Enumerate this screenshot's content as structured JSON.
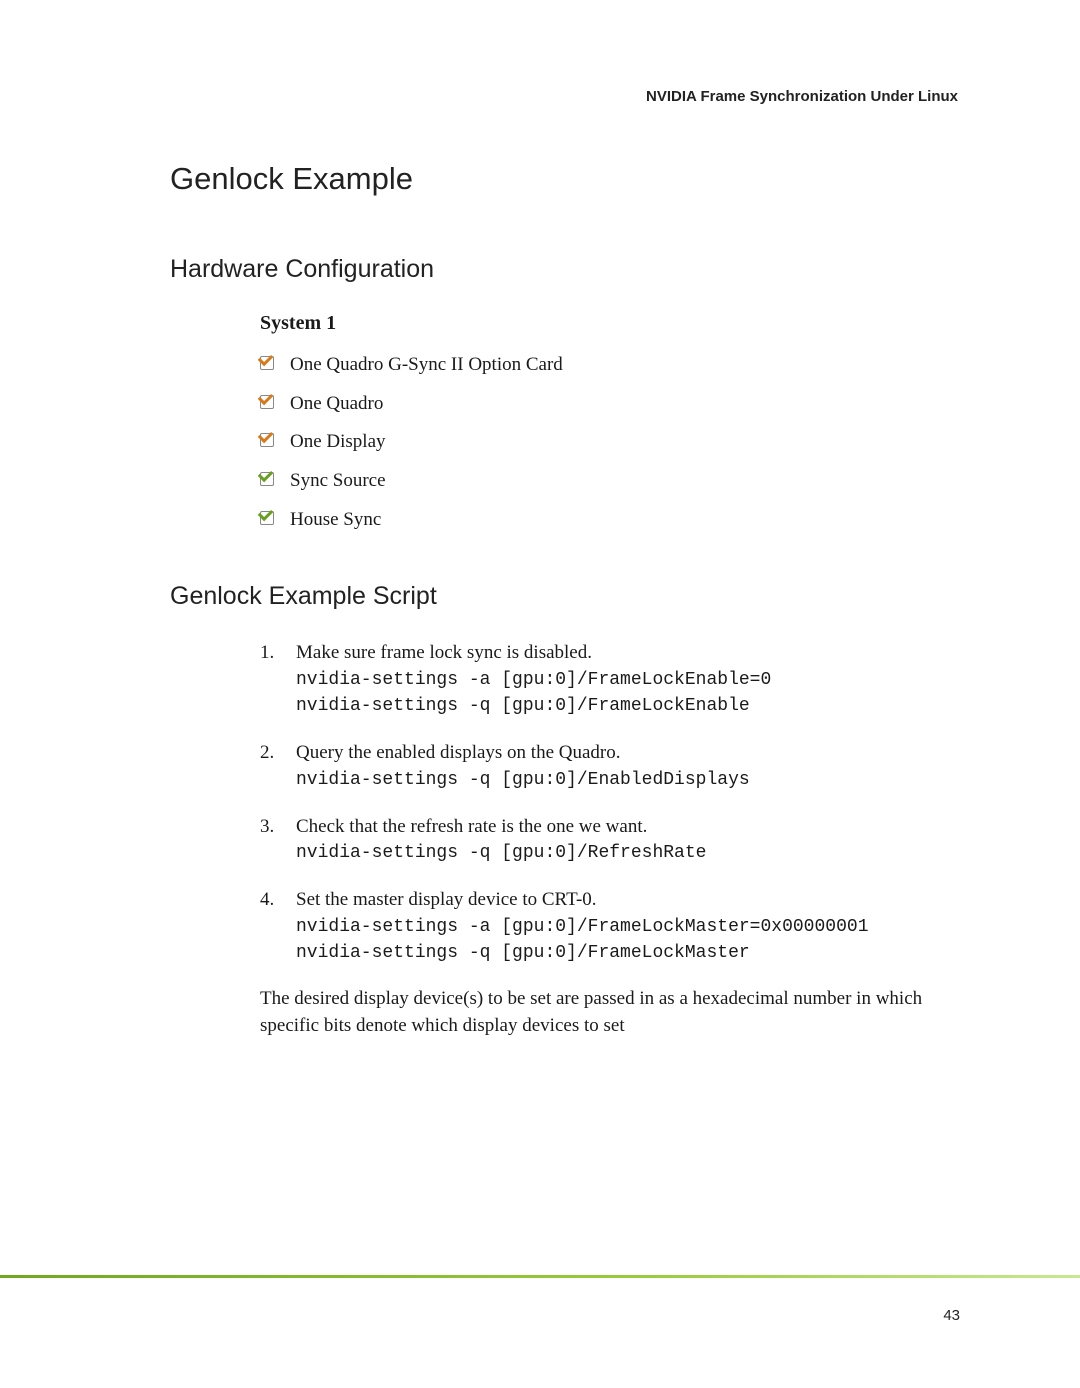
{
  "running_head": "NVIDIA Frame Synchronization Under Linux",
  "h1": "Genlock Example",
  "section1": {
    "h2": "Hardware Configuration",
    "system_label": "System 1",
    "bullets": [
      "One Quadro G-Sync II Option Card",
      "One Quadro",
      "One Display",
      "Sync Source",
      "House Sync"
    ]
  },
  "section2": {
    "h2": "Genlock Example Script",
    "steps": [
      {
        "text": "Make sure frame lock sync is disabled.",
        "code": "nvidia-settings -a [gpu:0]/FrameLockEnable=0\nnvidia-settings -q [gpu:0]/FrameLockEnable"
      },
      {
        "text": "Query the enabled displays on the Quadro.",
        "code": "nvidia-settings -q [gpu:0]/EnabledDisplays"
      },
      {
        "text": "Check that the refresh rate is the one we want.",
        "code": "nvidia-settings -q [gpu:0]/RefreshRate"
      },
      {
        "text": "Set the master display device to CRT-0.",
        "code": "nvidia-settings -a [gpu:0]/FrameLockMaster=0x00000001\nnvidia-settings -q [gpu:0]/FrameLockMaster"
      }
    ],
    "closing_para": "The desired display device(s) to be set are passed in as a hexadecimal number in which specific bits denote which display devices to set"
  },
  "page_number": "43"
}
